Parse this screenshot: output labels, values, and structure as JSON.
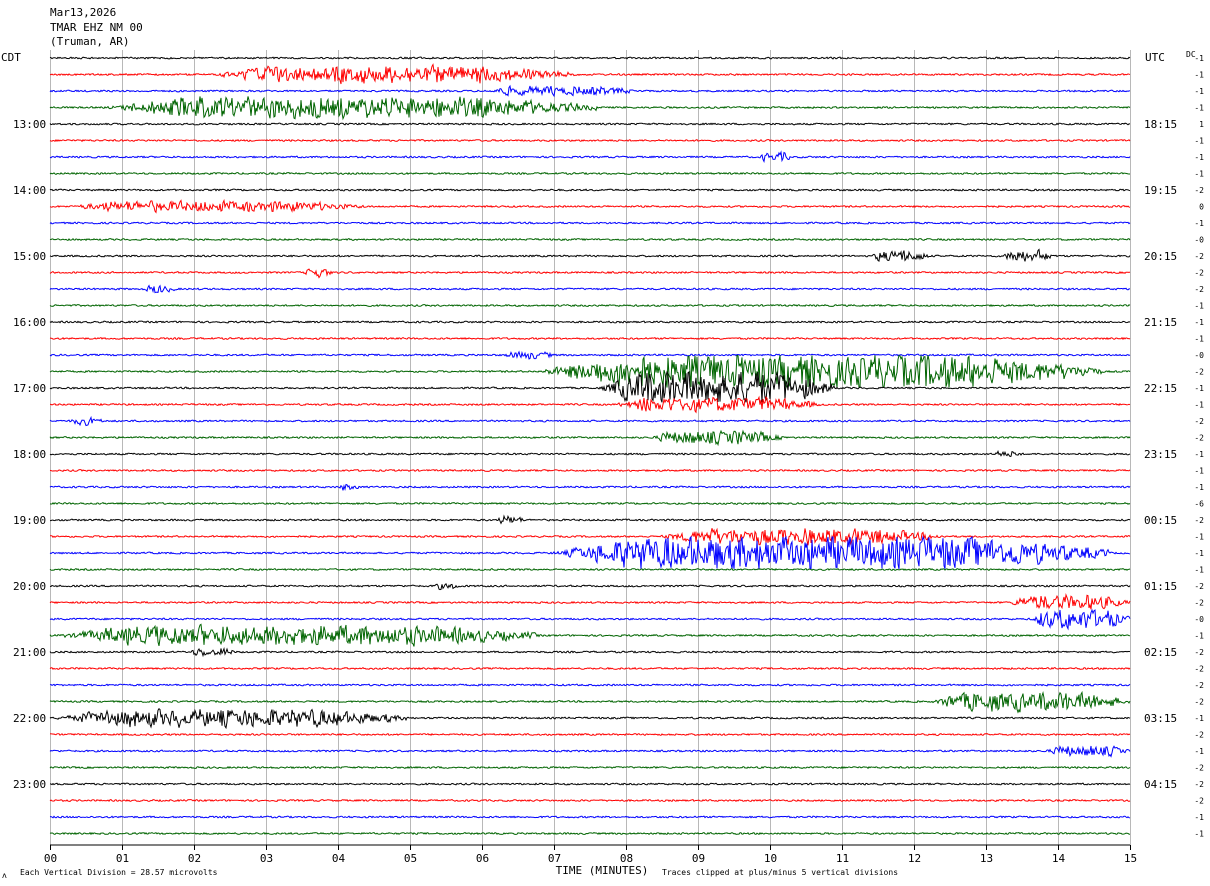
{
  "header": {
    "date": "Mar13,2026",
    "station": "TMAR EHZ NM 00",
    "location": "(Truman, AR)"
  },
  "labels": {
    "left_tz": "CDT",
    "right_tz": "UTC",
    "dc": "DC",
    "xlabel": "TIME (MINUTES)",
    "scale_note": "Each Vertical Division =   28.57 microvolts",
    "clip_note": "Traces clipped at plus/minus 5 vertical divisions",
    "corner_mark": "ʌ"
  },
  "chart_data": {
    "type": "line",
    "subtype": "helicorder",
    "xlim": [
      0,
      15
    ],
    "x_ticks": [
      "00",
      "01",
      "02",
      "03",
      "04",
      "05",
      "06",
      "07",
      "08",
      "09",
      "10",
      "11",
      "12",
      "13",
      "14",
      "15"
    ],
    "grid_vertical": true,
    "trace_count": 48,
    "minutes_per_trace": 15,
    "trace_colors": [
      "#000000",
      "#ff0000",
      "#0000ff",
      "#006400"
    ],
    "left_hour_labels": [
      "13:00",
      "14:00",
      "15:00",
      "16:00",
      "17:00",
      "18:00",
      "19:00",
      "20:00",
      "21:00",
      "22:00",
      "23:00"
    ],
    "right_hour_labels": [
      "18:15",
      "19:15",
      "20:15",
      "21:15",
      "22:15",
      "23:15",
      "00:15",
      "01:15",
      "02:15",
      "03:15",
      "04:15"
    ],
    "first_labeled_trace": 4,
    "dc_offsets": [
      "-1",
      "-1",
      "-1",
      "-1",
      "1",
      "-1",
      "-1",
      "-1",
      "-2",
      "0",
      "-1",
      "-0",
      "-2",
      "-2",
      "-2",
      "-1",
      "-1",
      "-1",
      "-0",
      "-2",
      "-1",
      "-1",
      "-2",
      "-2",
      "-1",
      "-1",
      "-1",
      "-6",
      "-2",
      "-1",
      "-1",
      "-1",
      "-2",
      "-2",
      "-0",
      "-1",
      "-2",
      "-2",
      "-2",
      "-2",
      "-1",
      "-2",
      "-1",
      "-2",
      "-2",
      "-2",
      "-1",
      "-1"
    ],
    "clip_divisions": 5,
    "division_microvolts": 28.57,
    "events": [
      {
        "trace": 1,
        "start": 2.2,
        "end": 7.3,
        "amp": 2.6
      },
      {
        "trace": 2,
        "start": 6.0,
        "end": 8.2,
        "amp": 1.4
      },
      {
        "trace": 3,
        "start": 0.7,
        "end": 7.6,
        "amp": 3.2
      },
      {
        "trace": 6,
        "start": 9.85,
        "end": 10.3,
        "amp": 1.4
      },
      {
        "trace": 9,
        "start": 0.2,
        "end": 4.4,
        "amp": 1.6
      },
      {
        "trace": 12,
        "start": 11.4,
        "end": 12.2,
        "amp": 1.8
      },
      {
        "trace": 12,
        "start": 13.2,
        "end": 13.95,
        "amp": 1.8
      },
      {
        "trace": 13,
        "start": 3.5,
        "end": 3.95,
        "amp": 1.4
      },
      {
        "trace": 14,
        "start": 1.3,
        "end": 1.75,
        "amp": 1.2
      },
      {
        "trace": 18,
        "start": 6.3,
        "end": 7.0,
        "amp": 1.2
      },
      {
        "trace": 19,
        "start": 6.7,
        "end": 14.6,
        "amp": 5.0
      },
      {
        "trace": 20,
        "start": 7.6,
        "end": 10.9,
        "amp": 5.0
      },
      {
        "trace": 21,
        "start": 7.8,
        "end": 10.7,
        "amp": 2.2
      },
      {
        "trace": 22,
        "start": 0.25,
        "end": 0.75,
        "amp": 1.2
      },
      {
        "trace": 23,
        "start": 8.3,
        "end": 10.2,
        "amp": 2.0
      },
      {
        "trace": 24,
        "start": 13.1,
        "end": 13.5,
        "amp": 1.0
      },
      {
        "trace": 26,
        "start": 4.0,
        "end": 4.3,
        "amp": 1.0
      },
      {
        "trace": 28,
        "start": 6.2,
        "end": 6.6,
        "amp": 1.2
      },
      {
        "trace": 29,
        "start": 8.4,
        "end": 12.4,
        "amp": 2.4
      },
      {
        "trace": 30,
        "start": 6.9,
        "end": 14.7,
        "amp": 5.0
      },
      {
        "trace": 32,
        "start": 5.3,
        "end": 5.7,
        "amp": 1.0
      },
      {
        "trace": 33,
        "start": 13.3,
        "end": 15.0,
        "amp": 2.2
      },
      {
        "trace": 34,
        "start": 13.6,
        "end": 15.0,
        "amp": 3.0
      },
      {
        "trace": 35,
        "start": 0.0,
        "end": 6.8,
        "amp": 3.0
      },
      {
        "trace": 36,
        "start": 1.9,
        "end": 2.6,
        "amp": 1.2
      },
      {
        "trace": 39,
        "start": 12.2,
        "end": 15.0,
        "amp": 2.8
      },
      {
        "trace": 40,
        "start": 0.0,
        "end": 5.0,
        "amp": 2.6
      },
      {
        "trace": 42,
        "start": 13.8,
        "end": 15.0,
        "amp": 1.6
      }
    ]
  }
}
